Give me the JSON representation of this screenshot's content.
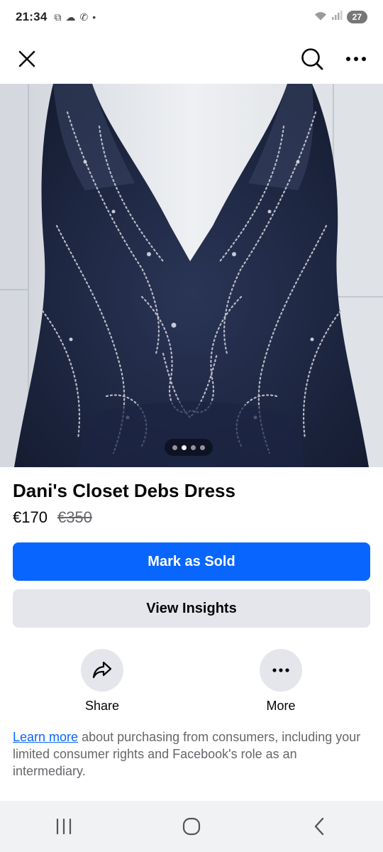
{
  "status_bar": {
    "time": "21:34",
    "battery": "27"
  },
  "listing": {
    "title": "Dani's Closet Debs Dress",
    "price": "€170",
    "original_price": "€350",
    "image_pager": {
      "count": 4,
      "active_index": 1
    }
  },
  "buttons": {
    "mark_sold": "Mark as Sold",
    "view_insights": "View Insights"
  },
  "actions": {
    "share_label": "Share",
    "more_label": "More"
  },
  "disclaimer": {
    "link_text": "Learn more",
    "text": " about purchasing from consumers, including your limited consumer rights and Facebook's role as an intermediary."
  },
  "colors": {
    "primary": "#0866ff",
    "secondary_bg": "#e4e6eb",
    "text": "#050505",
    "muted": "#65676b"
  }
}
